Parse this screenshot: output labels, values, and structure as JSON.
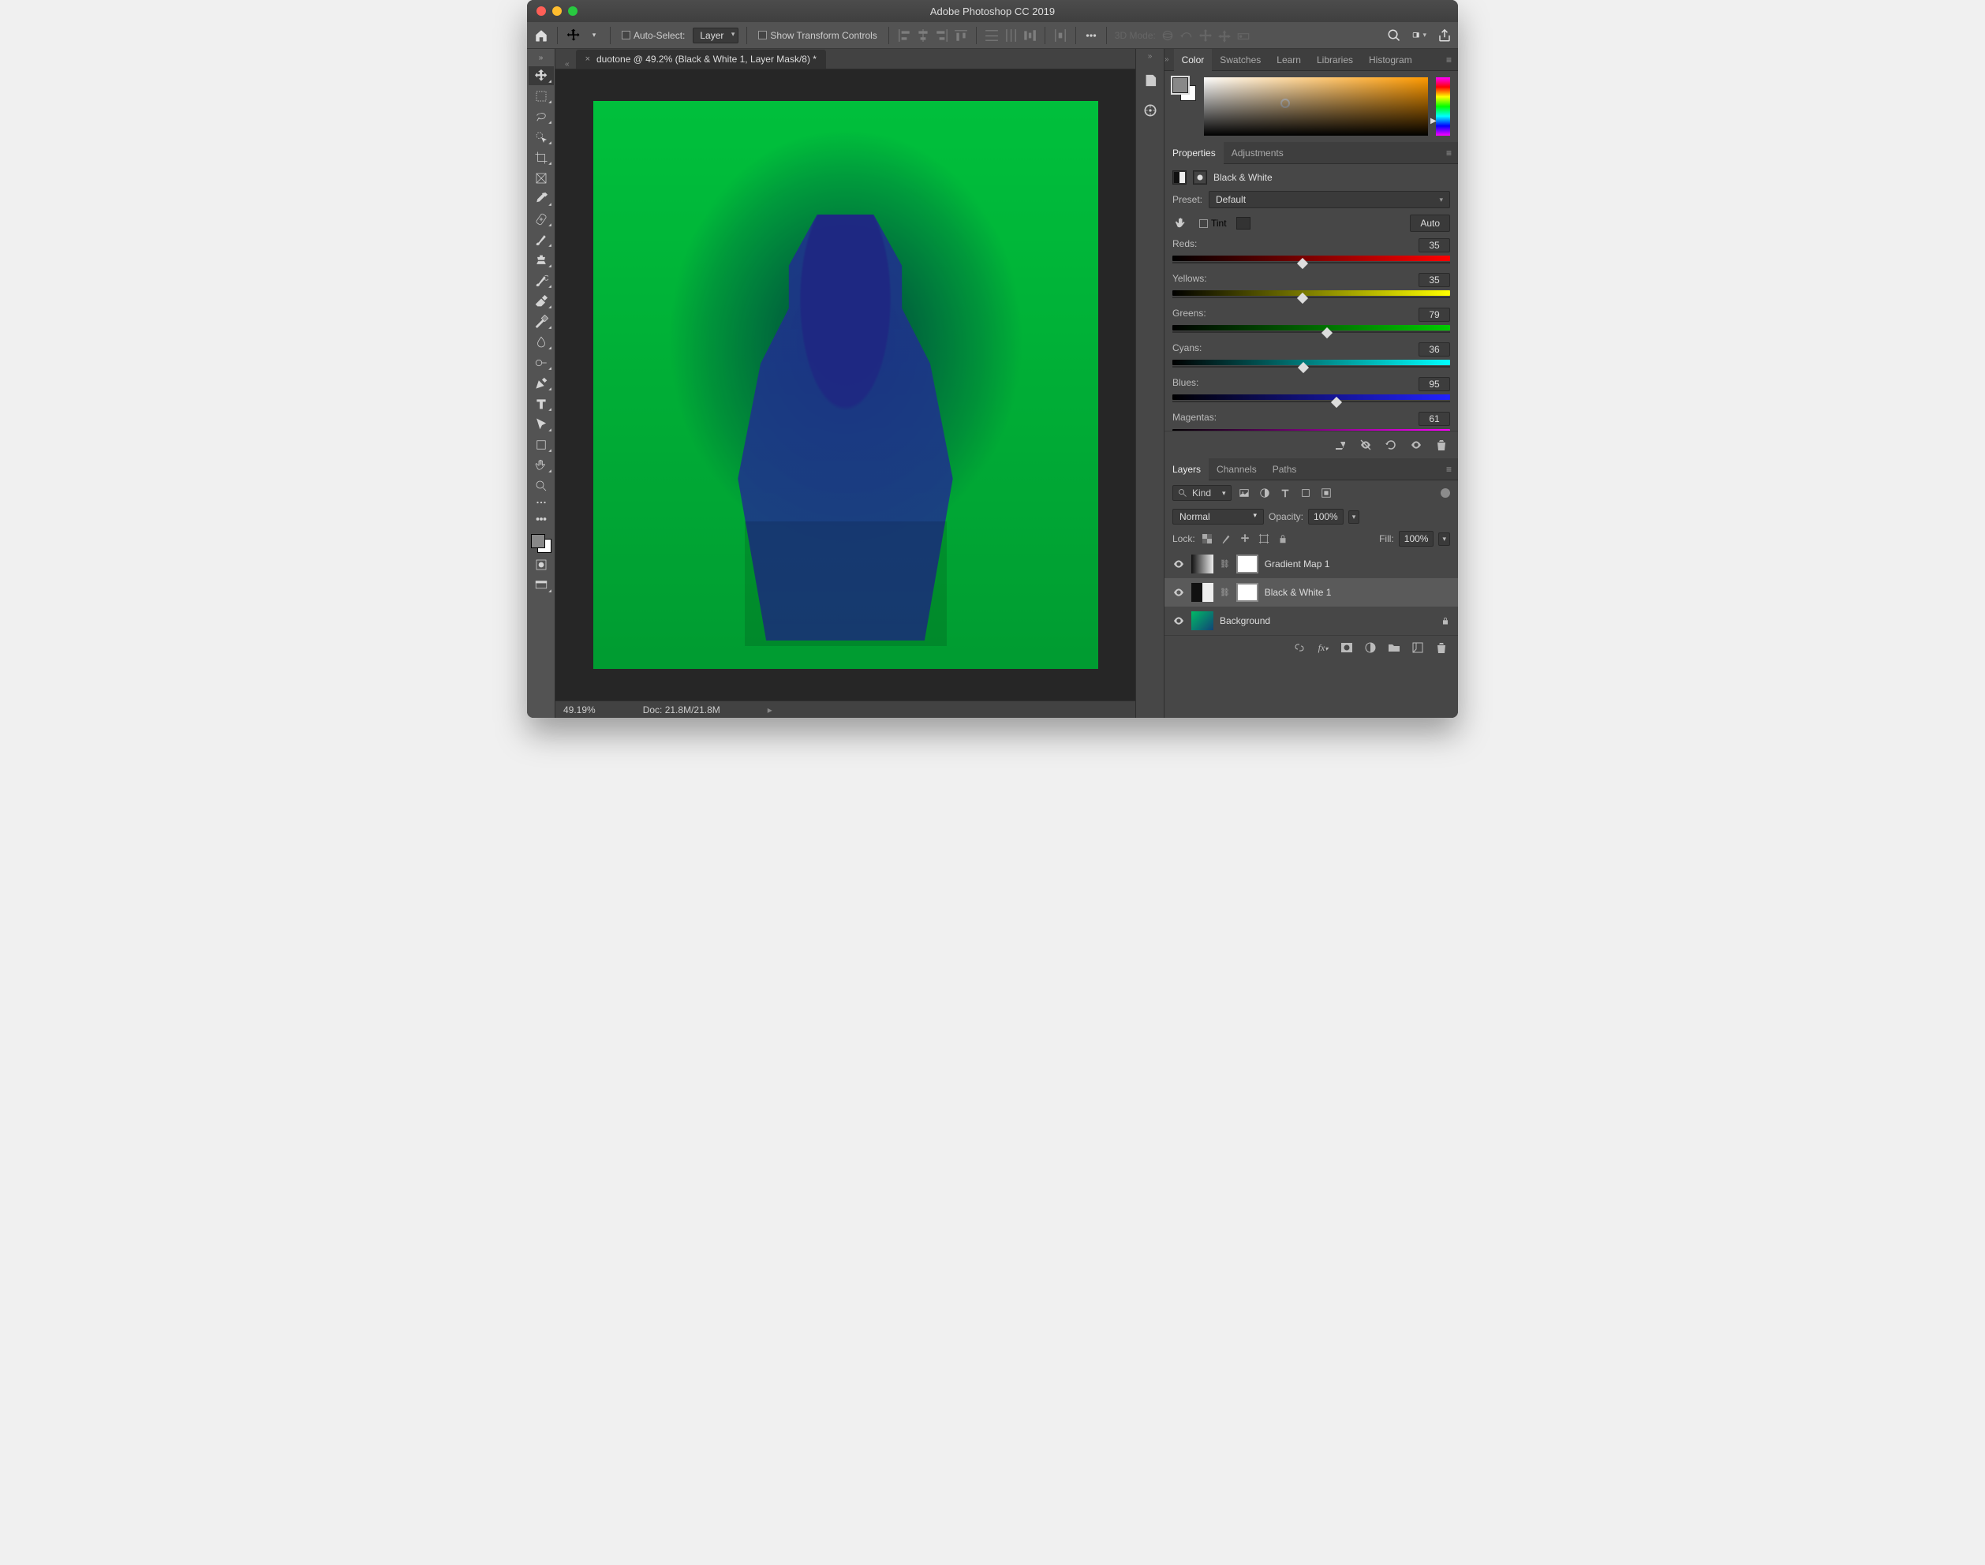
{
  "title": "Adobe Photoshop CC 2019",
  "options_bar": {
    "auto_select_label": "Auto-Select:",
    "target": "Layer",
    "transform_label": "Show Transform Controls",
    "mode3d_label": "3D Mode:"
  },
  "document": {
    "tab_title": "duotone @ 49.2% (Black & White 1, Layer Mask/8) *",
    "zoom_status": "49.19%",
    "doc_status": "Doc: 21.8M/21.8M"
  },
  "color_panel": {
    "tabs": [
      "Color",
      "Swatches",
      "Learn",
      "Libraries",
      "Histogram"
    ]
  },
  "properties": {
    "tabs": [
      "Properties",
      "Adjustments"
    ],
    "type_label": "Black & White",
    "preset_label": "Preset:",
    "preset_value": "Default",
    "tint_label": "Tint",
    "auto_label": "Auto",
    "channels": [
      {
        "name": "Reds:",
        "value": 35,
        "min": -200,
        "max": 300,
        "g": [
          "#000",
          "#f00"
        ]
      },
      {
        "name": "Yellows:",
        "value": 35,
        "min": -200,
        "max": 300,
        "g": [
          "#000",
          "#ff0"
        ]
      },
      {
        "name": "Greens:",
        "value": 79,
        "min": -200,
        "max": 300,
        "g": [
          "#000",
          "#0c0"
        ]
      },
      {
        "name": "Cyans:",
        "value": 36,
        "min": -200,
        "max": 300,
        "g": [
          "#000",
          "#0ff"
        ]
      },
      {
        "name": "Blues:",
        "value": 95,
        "min": -200,
        "max": 300,
        "g": [
          "#000",
          "#22f"
        ]
      },
      {
        "name": "Magentas:",
        "value": 61,
        "min": -200,
        "max": 300,
        "g": [
          "#000",
          "#f0f"
        ]
      }
    ]
  },
  "layers": {
    "tabs": [
      "Layers",
      "Channels",
      "Paths"
    ],
    "filter_label": "Kind",
    "blend_label": "Normal",
    "opacity_label": "Opacity:",
    "opacity_value": "100%",
    "lock_label": "Lock:",
    "fill_label": "Fill:",
    "fill_value": "100%",
    "items": [
      {
        "name": "Gradient Map 1",
        "type": "adj",
        "selected": false,
        "thumb": "grad"
      },
      {
        "name": "Black & White 1",
        "type": "adj",
        "selected": true,
        "thumb": "bw"
      },
      {
        "name": "Background",
        "type": "bg",
        "selected": false,
        "locked": true
      }
    ]
  }
}
